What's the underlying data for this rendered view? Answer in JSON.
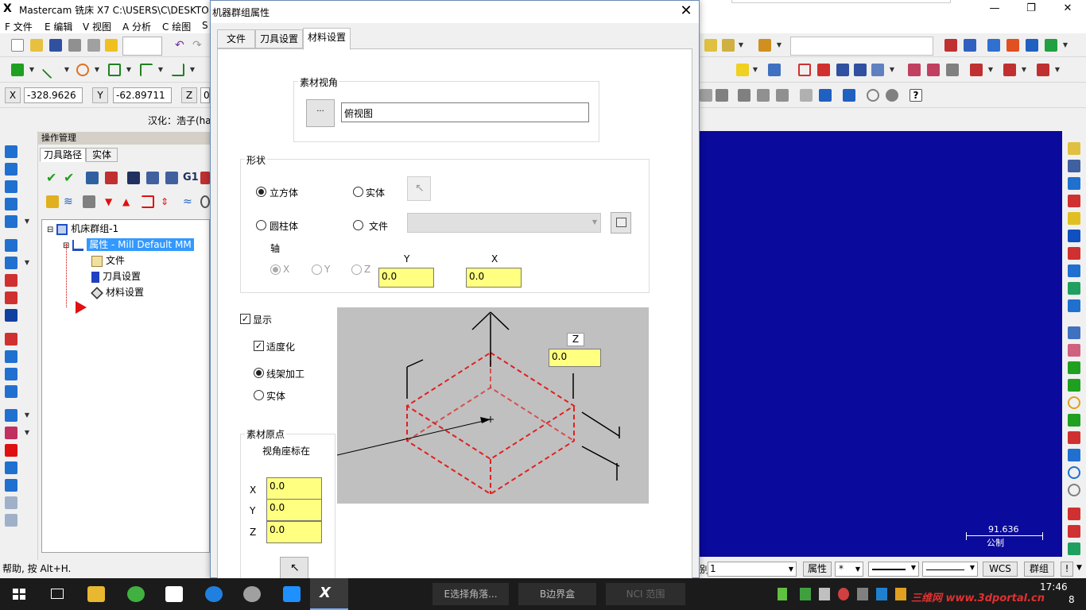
{
  "app": {
    "title": "Mastercam 铣床 X7   C:\\USERS\\C\\DESKTO",
    "logo": "X",
    "minimize": "—",
    "maximize": "❐",
    "close": "✕"
  },
  "menu": [
    "F 文件",
    "E 编辑",
    "V 视图",
    "A 分析",
    "C 绘图",
    "S"
  ],
  "coords": {
    "x_label": "X",
    "x_value": "-328.9626",
    "y_label": "Y",
    "y_value": "-62.89711",
    "z_label": "Z",
    "z_value": "0"
  },
  "hanhua": "汉化：浩子(ha",
  "opmgr": {
    "title": "操作管理",
    "tabs": [
      "刀具路径",
      "实体"
    ],
    "toolbar_text": "G1",
    "tree": {
      "root": "机床群组-1",
      "properties": "属性 - Mill Default MM",
      "files": "文件",
      "tool_settings": "刀具设置",
      "stock_settings": "材料设置"
    }
  },
  "status_help": "帮助, 按 Alt+H.",
  "dialog": {
    "title": "机器群组属性",
    "close": "✕",
    "tabs": [
      "文件",
      "刀具设置",
      "材料设置"
    ],
    "stock_view": {
      "title": "素材视角",
      "button_icon": "···",
      "value": "俯视图"
    },
    "shape": {
      "title": "形状",
      "rect": "立方体",
      "solid": "实体",
      "cylinder": "圆柱体",
      "file": "文件",
      "axis_label": "轴",
      "axis_x": "X",
      "axis_y": "Y",
      "axis_z": "Z",
      "y_label": "Y",
      "y_value": "0.0",
      "x_label": "X",
      "x_value": "0.0"
    },
    "display": {
      "show": "显示",
      "fit": "适度化",
      "wireframe": "线架加工",
      "solid": "实体"
    },
    "preview": {
      "z_label": "Z",
      "z_value": "0.0"
    },
    "origin": {
      "title": "素材原点",
      "subtitle": "视角座标在",
      "x_label": "X",
      "x_value": "0.0",
      "y_label": "Y",
      "y_value": "0.0",
      "z_label": "Z",
      "z_value": "0.0"
    }
  },
  "gfx": {
    "scale_value": "91.636",
    "scale_unit": "公制"
  },
  "bottom_bar": {
    "level": "1",
    "attr_button": "属性",
    "star": "*",
    "wcs_button": "WCS",
    "group_button": "群组",
    "excl": "!"
  },
  "taskbar": {
    "btn1": "E选择角落...",
    "btn2": "B边界盒",
    "btn3": "NCI 范围",
    "time": "17:46",
    "date_suffix": "8",
    "watermark": "三维网 www.3dportal.cn"
  },
  "colors": {
    "gfx_bg": "#0a0a9c",
    "yellow_field": "#ffff80",
    "stock_dash": "#e02020"
  }
}
